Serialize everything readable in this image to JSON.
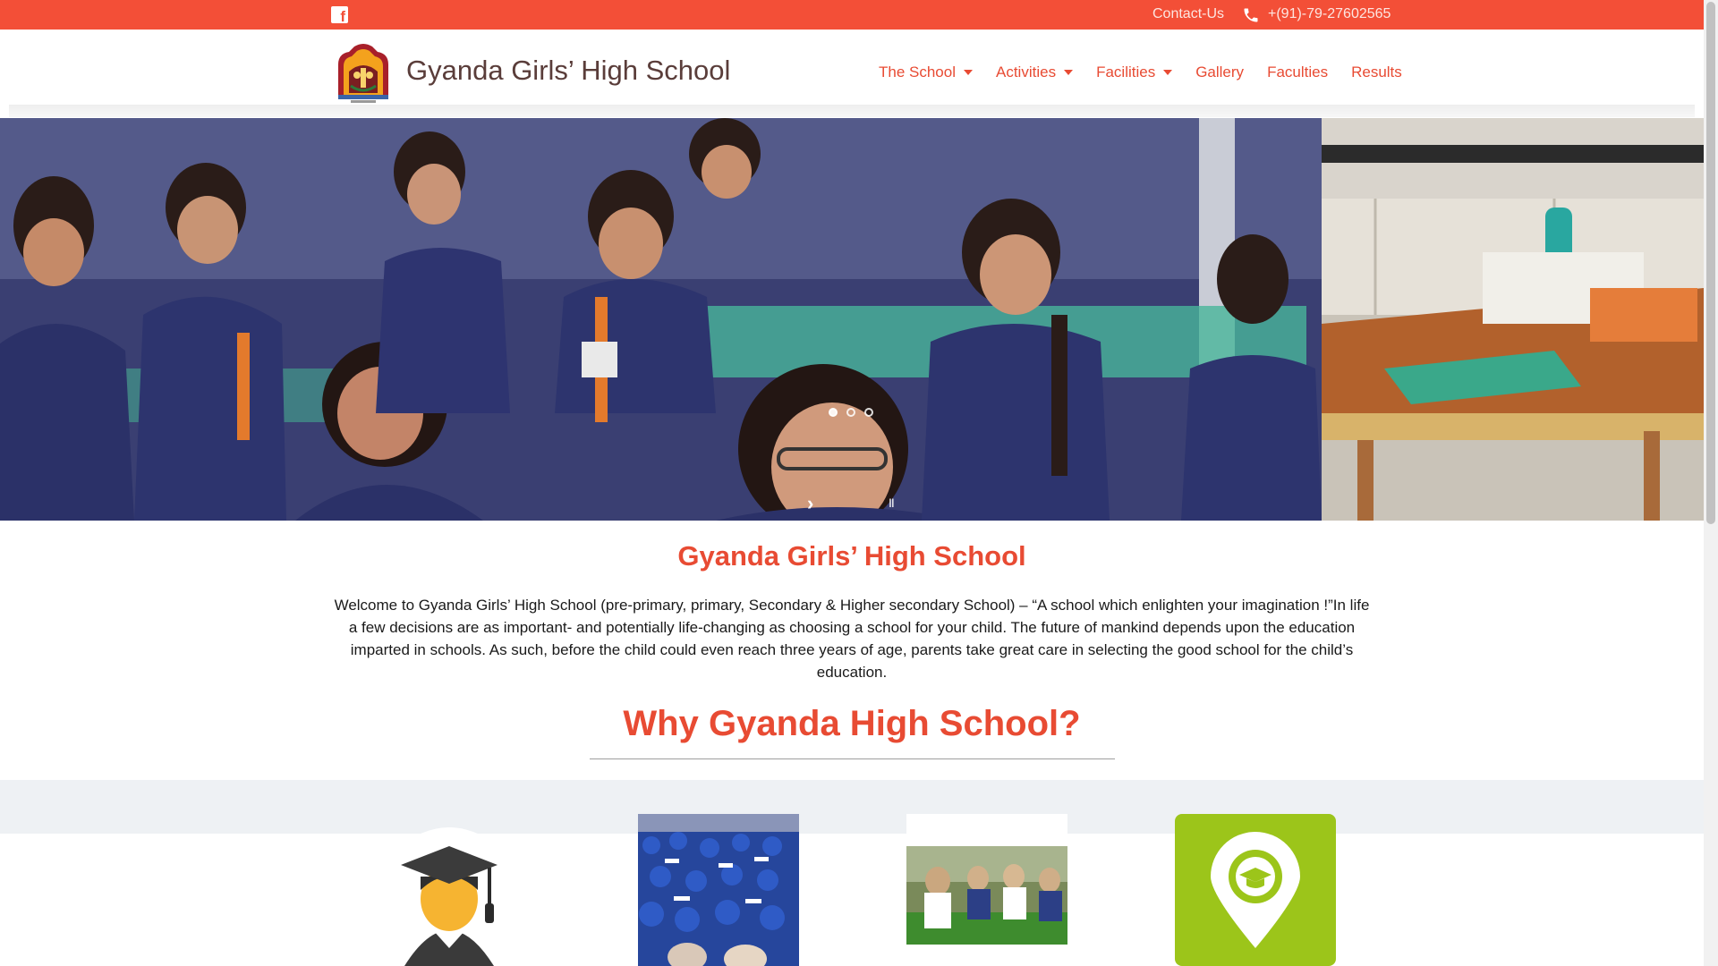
{
  "topbar": {
    "facebook_icon": "facebook-icon",
    "contact_label": "Contact-Us",
    "phone_icon": "phone-icon",
    "phone": "+(91)-79-27602565",
    "color": "#f34f37"
  },
  "header": {
    "site_title": "Gyanda Girls’ High School",
    "logo_icon": "school-crest-logo"
  },
  "nav": {
    "items": [
      {
        "label": "The School",
        "dropdown": true
      },
      {
        "label": "Activities",
        "dropdown": true
      },
      {
        "label": "Facilities",
        "dropdown": true
      },
      {
        "label": "Gallery",
        "dropdown": false
      },
      {
        "label": "Faculties",
        "dropdown": false
      },
      {
        "label": "Results",
        "dropdown": false
      }
    ]
  },
  "slider": {
    "slide_count": 3,
    "active_slide": 1,
    "next_glyph": "›",
    "pause_glyph": "II"
  },
  "intro": {
    "heading": "Gyanda Girls’ High School",
    "text": "Welcome to Gyanda Girls’ High School (pre-primary, primary, Secondary & Higher secondary School) – “A school which enlighten your imagination !”In life a few decisions are as important- and potentially life-changing as choosing a school for your child. The future of mankind depends upon the education imparted in schools. As such, before the child could even reach three years of age, parents take great care in selecting the good school for the child’s education."
  },
  "why": {
    "heading": "Why Gyanda High School?",
    "features": [
      {
        "icon": "graduate-icon"
      },
      {
        "icon": "graduation-ceremony-image"
      },
      {
        "icon": "students-running-image"
      },
      {
        "icon": "school-location-pin-icon"
      }
    ]
  },
  "colors": {
    "accent": "#e84b33",
    "title": "#5a3d3a",
    "location_green": "#9cc51a"
  }
}
